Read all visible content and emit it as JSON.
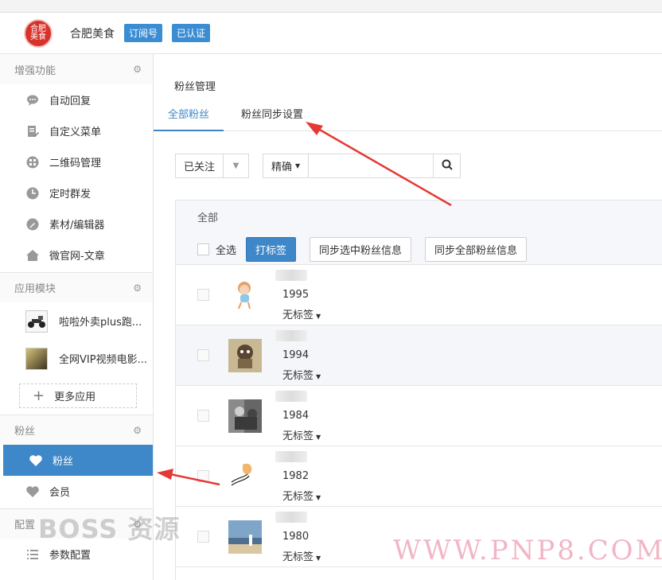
{
  "header": {
    "logo_text": "合肥美食",
    "account_name": "合肥美食",
    "badge_subscription": "订阅号",
    "badge_verified": "已认证"
  },
  "sidebar": {
    "enhance_title": "增强功能",
    "enhance_items": [
      {
        "label": "自动回复",
        "icon": "chat-bubble-icon"
      },
      {
        "label": "自定义菜单",
        "icon": "edit-doc-icon"
      },
      {
        "label": "二维码管理",
        "icon": "qrcode-icon"
      },
      {
        "label": "定时群发",
        "icon": "clock-icon"
      },
      {
        "label": "素材/编辑器",
        "icon": "pencil-icon"
      },
      {
        "label": "微官网-文章",
        "icon": "home-icon"
      }
    ],
    "apps_title": "应用模块",
    "apps": [
      {
        "label": "啦啦外卖plus跑..."
      },
      {
        "label": "全网VIP视频电影..."
      }
    ],
    "more_apps": "更多应用",
    "fans_title": "粉丝",
    "fans_items": [
      {
        "label": "粉丝",
        "icon": "heart-icon"
      },
      {
        "label": "会员",
        "icon": "heart-icon"
      }
    ],
    "config_title": "配置",
    "config_items": [
      {
        "label": "参数配置",
        "icon": "list-icon"
      }
    ]
  },
  "main": {
    "page_title": "粉丝管理",
    "tabs": [
      "全部粉丝",
      "粉丝同步设置"
    ],
    "filter_status": "已关注",
    "search_mode": "精确",
    "search_value": "",
    "panel_title": "全部",
    "select_all": "全选",
    "btn_tag": "打标签",
    "btn_sync_selected": "同步选中粉丝信息",
    "btn_sync_all": "同步全部粉丝信息",
    "fans": [
      {
        "year": "1995",
        "tag": "无标签"
      },
      {
        "year": "1994",
        "tag": "无标签"
      },
      {
        "year": "1984",
        "tag": "无标签"
      },
      {
        "year": "1982",
        "tag": "无标签"
      },
      {
        "year": "1980",
        "tag": "无标签"
      }
    ]
  },
  "watermarks": {
    "boss": "BOSS 资源",
    "url": "WWW.PNP8.COM"
  },
  "colors": {
    "accent": "#3e87c9",
    "arrow": "#e53935",
    "logo": "#d7322b"
  }
}
